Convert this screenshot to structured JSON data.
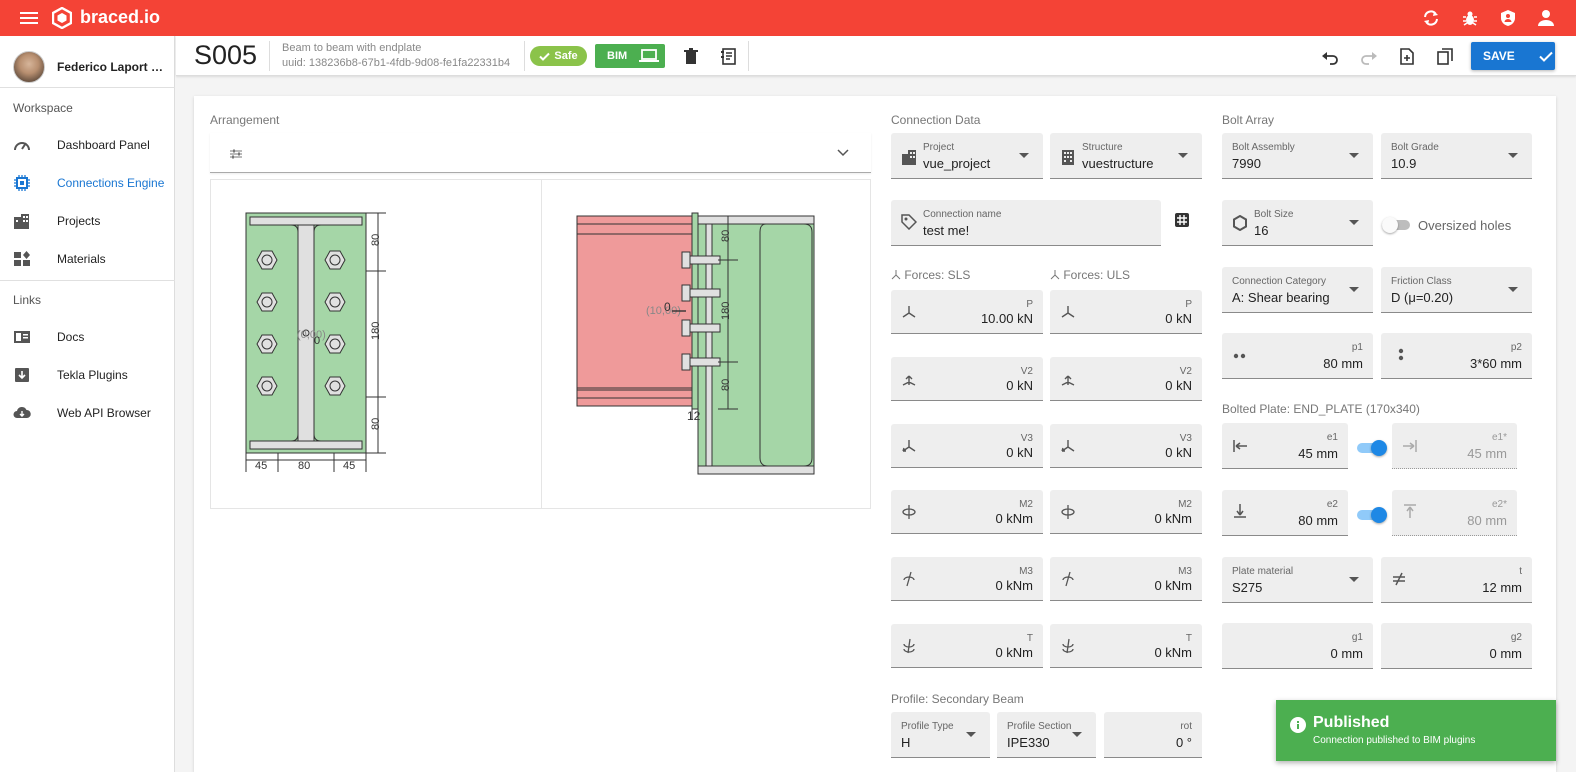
{
  "app": {
    "brand": "braced.io",
    "accent": "#f44336"
  },
  "sidebar": {
    "user": "Federico Laport Riv...",
    "workspace_label": "Workspace",
    "links_label": "Links",
    "items": [
      {
        "label": "Dashboard Panel",
        "icon": "gauge-icon"
      },
      {
        "label": "Connections Engine",
        "icon": "chip-icon",
        "active": true
      },
      {
        "label": "Projects",
        "icon": "buildings-icon"
      },
      {
        "label": "Materials",
        "icon": "materials-icon"
      }
    ],
    "links": [
      {
        "label": "Docs",
        "icon": "book-icon"
      },
      {
        "label": "Tekla Plugins",
        "icon": "download-box-icon"
      },
      {
        "label": "Web API Browser",
        "icon": "cloud-download-icon"
      }
    ]
  },
  "toolbar": {
    "code": "S005",
    "description": "Beam to beam with endplate",
    "uuid": "uuid: 138236b8-67b1-4fdb-9d08-fe1fa22331b4",
    "status": "Safe",
    "bim": "BIM",
    "save": "SAVE"
  },
  "arrangement": {
    "label": "Arrangement"
  },
  "drawing": {
    "front": {
      "dim_v": [
        "80",
        "180",
        "80"
      ],
      "dim_h": [
        "45",
        "80",
        "45"
      ],
      "center_label": "(0,00)",
      "center_value": "0"
    },
    "side": {
      "dim_v": [
        "80",
        "180",
        "80"
      ],
      "load_label": "(10,00)",
      "load_value": "0",
      "plate_t": "12"
    }
  },
  "connection": {
    "label": "Connection Data",
    "project": {
      "label": "Project",
      "value": "vue_project"
    },
    "structure": {
      "label": "Structure",
      "value": "vuestructure"
    },
    "name": {
      "label": "Connection name",
      "value": "test me!"
    }
  },
  "forces": {
    "sls_label": "Forces: SLS",
    "uls_label": "Forces: ULS",
    "sls": [
      {
        "label": "P",
        "value": "10.00 kN"
      },
      {
        "label": "V2",
        "value": "0 kN"
      },
      {
        "label": "V3",
        "value": "0 kN"
      },
      {
        "label": "M2",
        "value": "0 kNm"
      },
      {
        "label": "M3",
        "value": "0 kNm"
      },
      {
        "label": "T",
        "value": "0 kNm"
      }
    ],
    "uls": [
      {
        "label": "P",
        "value": "0 kN"
      },
      {
        "label": "V2",
        "value": "0 kN"
      },
      {
        "label": "V3",
        "value": "0 kN"
      },
      {
        "label": "M2",
        "value": "0 kNm"
      },
      {
        "label": "M3",
        "value": "0 kNm"
      },
      {
        "label": "T",
        "value": "0 kNm"
      }
    ]
  },
  "profile": {
    "label": "Profile: Secondary Beam",
    "type": {
      "label": "Profile Type",
      "value": "H"
    },
    "section": {
      "label": "Profile Section",
      "value": "IPE330"
    },
    "rot": {
      "label": "rot",
      "value": "0 °"
    }
  },
  "bolts": {
    "label": "Bolt Array",
    "assembly": {
      "label": "Bolt Assembly",
      "value": "7990"
    },
    "grade": {
      "label": "Bolt Grade",
      "value": "10.9"
    },
    "size": {
      "label": "Bolt Size",
      "value": "16"
    },
    "oversized": "Oversized holes",
    "category": {
      "label": "Connection Category",
      "value": "A: Shear bearing"
    },
    "friction": {
      "label": "Friction Class",
      "value": "D (μ=0.20)"
    },
    "p1": {
      "label": "p1",
      "value": "80 mm"
    },
    "p2": {
      "label": "p2",
      "value": "3*60 mm"
    }
  },
  "plate": {
    "label": "Bolted Plate: END_PLATE (170x340)",
    "e1": {
      "label": "e1",
      "value": "45 mm"
    },
    "e1s": {
      "label": "e1*",
      "value": "45 mm"
    },
    "e2": {
      "label": "e2",
      "value": "80 mm"
    },
    "e2s": {
      "label": "e2*",
      "value": "80 mm"
    },
    "material": {
      "label": "Plate material",
      "value": "S275"
    },
    "t": {
      "label": "t",
      "value": "12 mm"
    },
    "g1": {
      "label": "g1",
      "value": "0 mm"
    },
    "g2": {
      "label": "g2",
      "value": "0 mm"
    }
  },
  "snackbar": {
    "title": "Published",
    "message": "Connection published to BIM plugins"
  }
}
